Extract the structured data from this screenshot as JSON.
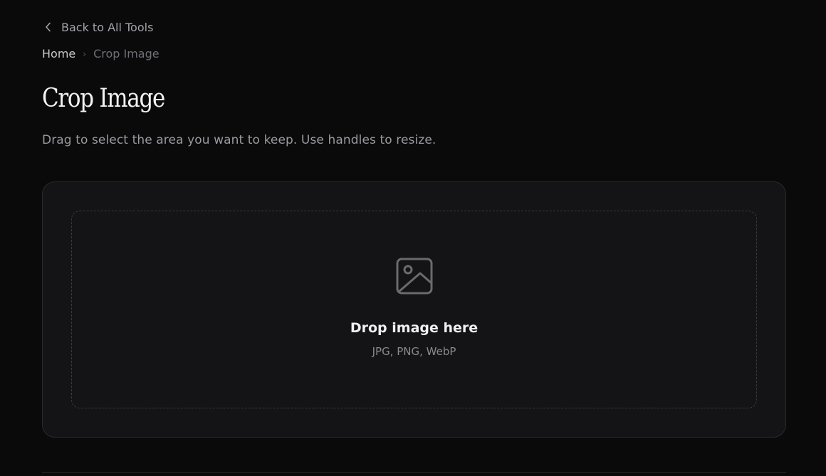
{
  "nav": {
    "back_label": "Back to All Tools",
    "back_icon": "chevron-left-icon"
  },
  "breadcrumb": {
    "home": "Home",
    "separator": "›",
    "current": "Crop Image"
  },
  "header": {
    "title": "Crop Image",
    "subtitle": "Drag to select the area you want to keep. Use handles to resize."
  },
  "dropzone": {
    "icon": "image-icon",
    "title": "Drop image here",
    "formats": "JPG, PNG, WebP"
  },
  "colors": {
    "background": "#0a0a0b",
    "card": "#141416",
    "border": "#2a2a2e",
    "text_primary": "#f0f0f0",
    "text_muted": "#9a9a9f"
  }
}
